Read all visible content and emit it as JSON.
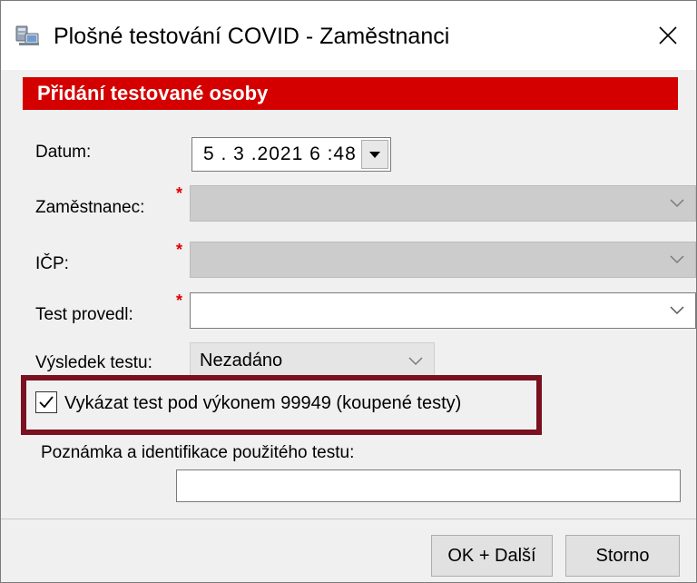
{
  "window": {
    "title": "Plošné testování COVID - Zaměstnanci",
    "icon": "computer-network-icon",
    "close_icon": "close-icon"
  },
  "section": {
    "header": "Přidání testované osoby"
  },
  "form": {
    "date": {
      "label": "Datum:",
      "value": "5 . 3 .2021  6 :48"
    },
    "employee": {
      "label": "Zaměstnanec:",
      "required_mark": "*",
      "value": ""
    },
    "icp": {
      "label": "IČP:",
      "required_mark": "*",
      "value": ""
    },
    "tested_by": {
      "label": "Test provedl:",
      "required_mark": "*",
      "value": ""
    },
    "result": {
      "label": "Výsledek testu:",
      "value": "Nezadáno"
    },
    "report_checkbox": {
      "label": "Vykázat test pod výkonem 99949 (koupené testy)",
      "checked": true
    },
    "note": {
      "label": "Poznámka a identifikace použitého testu:",
      "value": ""
    }
  },
  "buttons": {
    "ok_next": "OK + Další",
    "cancel": "Storno"
  },
  "colors": {
    "header_red": "#d40000",
    "highlight_border": "#7a1020",
    "required_star": "#e00000"
  }
}
